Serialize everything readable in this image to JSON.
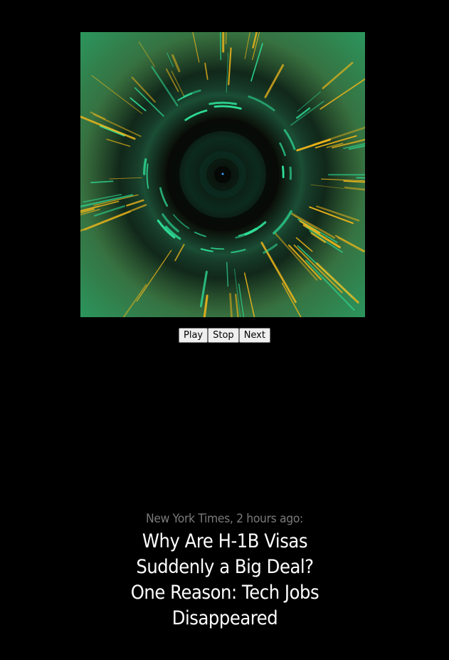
{
  "visualizer": {
    "colors": {
      "background": "#1a2a14",
      "green": "#2fe39a",
      "gold": "#f2b81a",
      "dark": "#050505"
    }
  },
  "controls": {
    "play_label": "Play",
    "stop_label": "Stop",
    "next_label": "Next"
  },
  "news": {
    "source": "New York Times, 2 hours ago:",
    "headline": "Why Are H-1B Visas Suddenly a Big Deal? One Reason: Tech Jobs Disappeared"
  }
}
